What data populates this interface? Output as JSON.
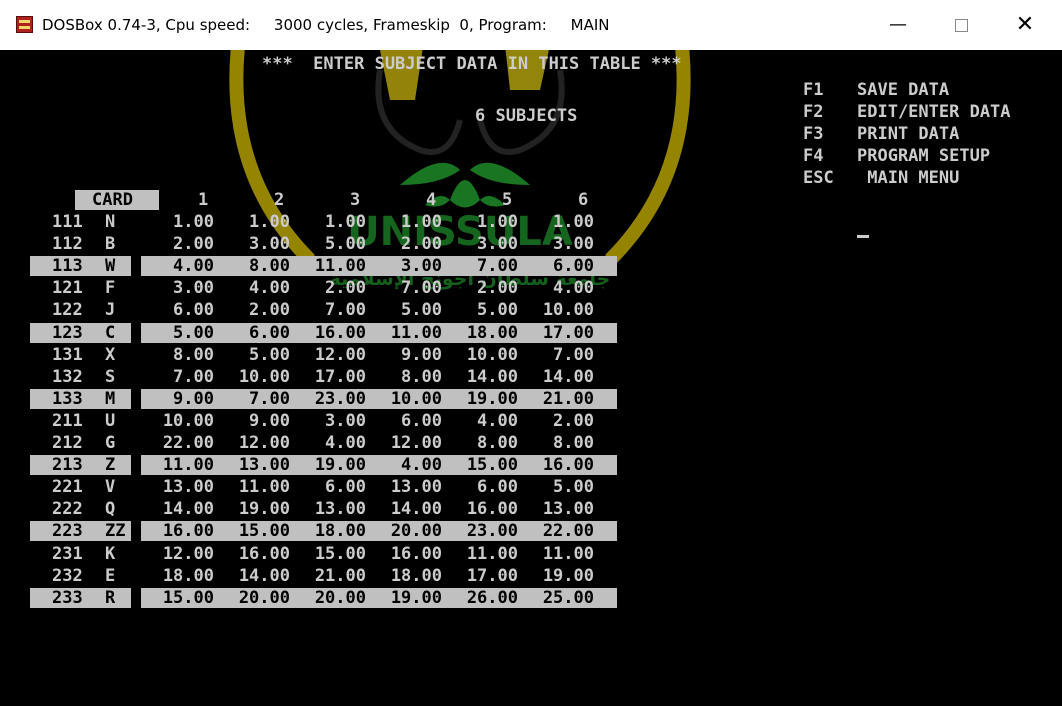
{
  "window": {
    "title": "DOSBox 0.74-3, Cpu speed:     3000 cycles, Frameskip  0, Program:     MAIN",
    "buttons": {
      "minimize": "—",
      "close": "✕"
    }
  },
  "screen": {
    "header": "***  ENTER SUBJECT DATA IN THIS TABLE ***",
    "subjects_label": "6 SUBJECTS",
    "menu": [
      {
        "key": "F1",
        "label": "SAVE DATA"
      },
      {
        "key": "F2",
        "label": "EDIT/ENTER DATA"
      },
      {
        "key": "F3",
        "label": "PRINT DATA"
      },
      {
        "key": "F4",
        "label": "PROGRAM SETUP"
      },
      {
        "key": "ESC",
        "label": " MAIN MENU"
      }
    ],
    "columns": {
      "card": "CARD",
      "numbers": [
        "1",
        "2",
        "3",
        "4",
        "5",
        "6"
      ]
    },
    "rows": [
      {
        "num": "111",
        "code": "N",
        "values": [
          "1.00",
          "1.00",
          "1.00",
          "1.00",
          "1.00",
          "1.00"
        ]
      },
      {
        "num": "112",
        "code": "B",
        "values": [
          "2.00",
          "3.00",
          "5.00",
          "2.00",
          "3.00",
          "3.00"
        ]
      },
      {
        "num": "113",
        "code": "W",
        "values": [
          "4.00",
          "8.00",
          "11.00",
          "3.00",
          "7.00",
          "6.00"
        ]
      },
      {
        "num": "121",
        "code": "F",
        "values": [
          "3.00",
          "4.00",
          "2.00",
          "7.00",
          "2.00",
          "4.00"
        ]
      },
      {
        "num": "122",
        "code": "J",
        "values": [
          "6.00",
          "2.00",
          "7.00",
          "5.00",
          "5.00",
          "10.00"
        ]
      },
      {
        "num": "123",
        "code": "C",
        "values": [
          "5.00",
          "6.00",
          "16.00",
          "11.00",
          "18.00",
          "17.00"
        ]
      },
      {
        "num": "131",
        "code": "X",
        "values": [
          "8.00",
          "5.00",
          "12.00",
          "9.00",
          "10.00",
          "7.00"
        ]
      },
      {
        "num": "132",
        "code": "S",
        "values": [
          "7.00",
          "10.00",
          "17.00",
          "8.00",
          "14.00",
          "14.00"
        ]
      },
      {
        "num": "133",
        "code": "M",
        "values": [
          "9.00",
          "7.00",
          "23.00",
          "10.00",
          "19.00",
          "21.00"
        ]
      },
      {
        "num": "211",
        "code": "U",
        "values": [
          "10.00",
          "9.00",
          "3.00",
          "6.00",
          "4.00",
          "2.00"
        ]
      },
      {
        "num": "212",
        "code": "G",
        "values": [
          "22.00",
          "12.00",
          "4.00",
          "12.00",
          "8.00",
          "8.00"
        ]
      },
      {
        "num": "213",
        "code": "Z",
        "values": [
          "11.00",
          "13.00",
          "19.00",
          "4.00",
          "15.00",
          "16.00"
        ]
      },
      {
        "num": "221",
        "code": "V",
        "values": [
          "13.00",
          "11.00",
          "6.00",
          "13.00",
          "6.00",
          "5.00"
        ]
      },
      {
        "num": "222",
        "code": "Q",
        "values": [
          "14.00",
          "19.00",
          "13.00",
          "14.00",
          "16.00",
          "13.00"
        ]
      },
      {
        "num": "223",
        "code": "ZZ",
        "values": [
          "16.00",
          "15.00",
          "18.00",
          "20.00",
          "23.00",
          "22.00"
        ]
      },
      {
        "num": "231",
        "code": "K",
        "values": [
          "12.00",
          "16.00",
          "15.00",
          "16.00",
          "11.00",
          "11.00"
        ]
      },
      {
        "num": "232",
        "code": "E",
        "values": [
          "18.00",
          "14.00",
          "21.00",
          "18.00",
          "17.00",
          "19.00"
        ]
      },
      {
        "num": "233",
        "code": "R",
        "values": [
          "15.00",
          "20.00",
          "20.00",
          "19.00",
          "26.00",
          "25.00"
        ]
      }
    ],
    "highlighted_rows": [
      2,
      5,
      8,
      11,
      14,
      17
    ]
  },
  "watermark": {
    "text_top": "UNISSULA",
    "text_bottom": "جامعة سلطان أجونج الإسلامية"
  },
  "colors": {
    "highlight": "#c0c0c0",
    "text": "#cccccc",
    "background": "#000000"
  }
}
